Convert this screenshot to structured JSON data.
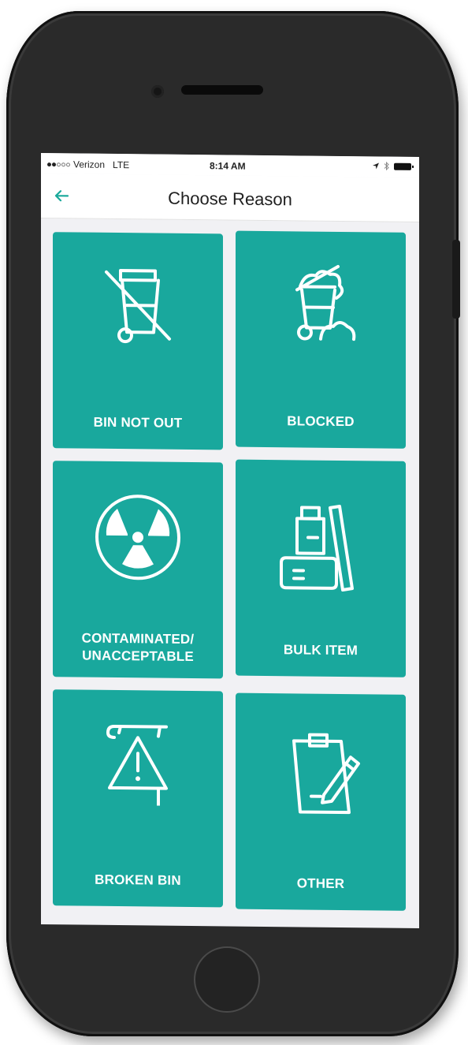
{
  "status_bar": {
    "carrier": "Verizon",
    "network": "LTE",
    "time": "8:14 AM"
  },
  "nav": {
    "title": "Choose Reason"
  },
  "reasons": [
    {
      "label": "BIN NOT OUT",
      "icon": "bin-crossed-icon"
    },
    {
      "label": "BLOCKED",
      "icon": "blocked-bin-icon"
    },
    {
      "label": "CONTAMINATED/\nUNACCEPTABLE",
      "icon": "radiation-icon"
    },
    {
      "label": "BULK ITEM",
      "icon": "bulk-boxes-icon"
    },
    {
      "label": "BROKEN BIN",
      "icon": "broken-bin-warning-icon"
    },
    {
      "label": "OTHER",
      "icon": "clipboard-pencil-icon"
    }
  ],
  "colors": {
    "accent": "#19a89d",
    "phone_body": "#2a2a2a",
    "screen_bg": "#f1f1f4"
  }
}
